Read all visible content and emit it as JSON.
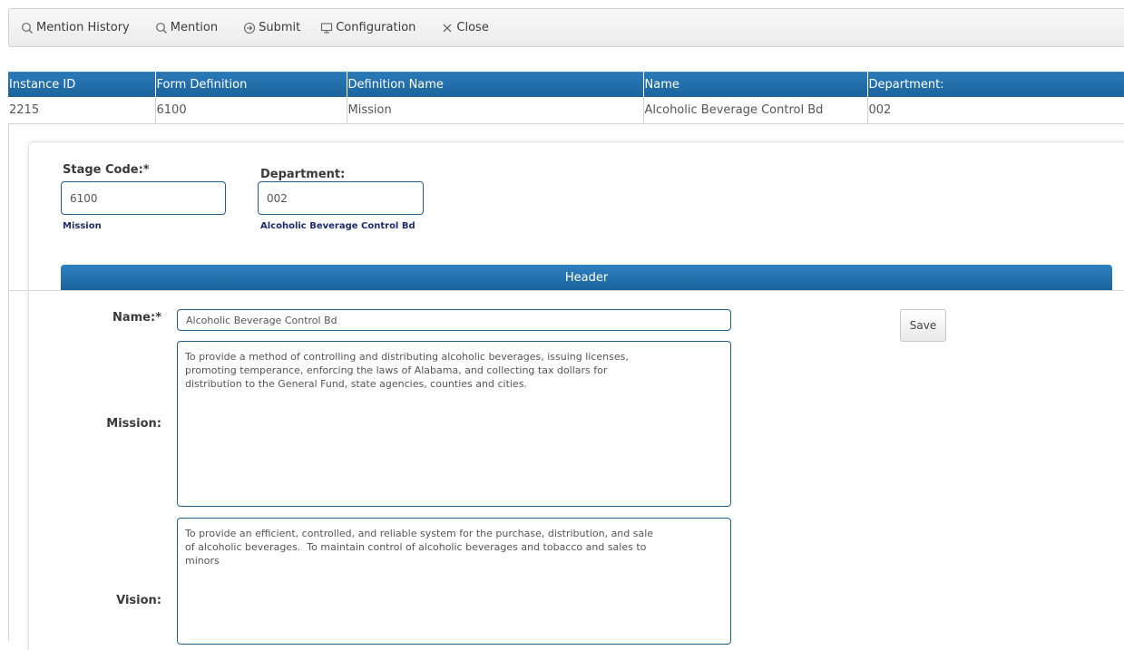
{
  "toolbar": {
    "items": [
      {
        "label": "Mention History",
        "icon": "search-icon"
      },
      {
        "label": "Mention",
        "icon": "search-icon"
      },
      {
        "label": "Submit",
        "icon": "circle-arrow-right-icon"
      },
      {
        "label": "Configuration",
        "icon": "monitor-icon"
      },
      {
        "label": "Close",
        "icon": "close-icon"
      }
    ]
  },
  "instance_table": {
    "headers": [
      "Instance ID",
      "Form Definition",
      "Definition Name",
      "Name",
      "Department:"
    ],
    "row": [
      "2215",
      "6100",
      "Mission",
      "Alcoholic Beverage Control Bd",
      "002"
    ]
  },
  "form": {
    "stage_code_label": "Stage Code:*",
    "stage_code_value": "6100",
    "stage_code_desc": "Mission",
    "department_label": "Department:",
    "department_value": "002",
    "department_desc": "Alcoholic Beverage Control Bd",
    "section_header": "Header",
    "name_label": "Name:*",
    "name_value": "Alcoholic Beverage Control Bd",
    "mission_label": "Mission:",
    "mission_value": "To provide a method of controlling and distributing alcoholic beverages, issuing licenses,\npromoting temperance, enforcing the laws of Alabama, and collecting tax dollars for\ndistribution to the General Fund, state agencies, counties and cities.",
    "vision_label": "Vision:",
    "vision_value": "To provide an efficient, controlled, and reliable system for the purchase, distribution, and sale\nof alcoholic beverages.  To maintain control of alcoholic beverages and tobacco and sales to\nminors",
    "save_label": "Save"
  },
  "colors": {
    "header_blue": "#1b639c",
    "input_border": "#1f5f8f",
    "desc_text": "#1e2b6e"
  }
}
